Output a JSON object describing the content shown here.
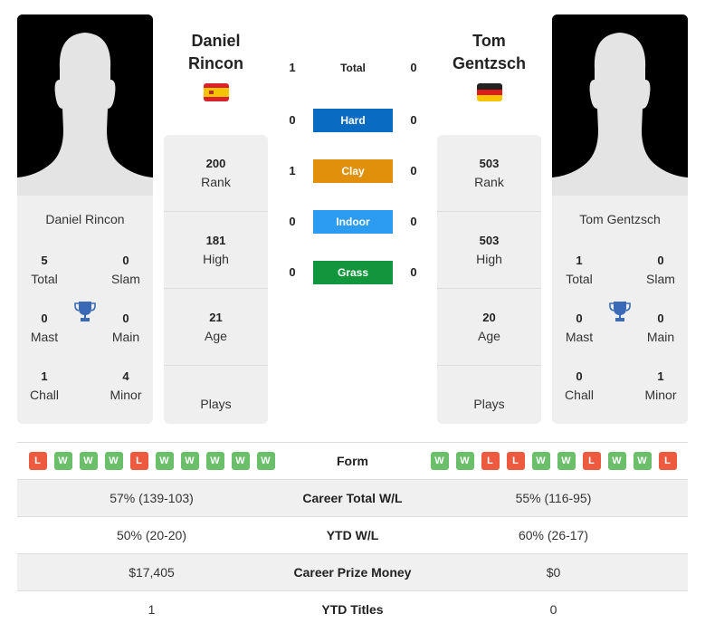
{
  "colors": {
    "hard": "#0a6bc2",
    "clay": "#e0900a",
    "indoor": "#2b9cf2",
    "grass": "#11963c",
    "win": "#6cbf6a",
    "loss": "#ee5a40",
    "trophy": "#3a6ab7"
  },
  "player1": {
    "name": "Daniel Rincon",
    "first_name": "Daniel",
    "last_name": "Rincon",
    "flag": "spain-flag",
    "titles": {
      "total": "5",
      "total_label": "Total",
      "slam": "0",
      "slam_label": "Slam",
      "mast": "0",
      "mast_label": "Mast",
      "main": "0",
      "main_label": "Main",
      "chall": "1",
      "chall_label": "Chall",
      "minor": "4",
      "minor_label": "Minor"
    },
    "info": {
      "rank": "200",
      "rank_label": "Rank",
      "high": "181",
      "high_label": "High",
      "age": "21",
      "age_label": "Age",
      "plays_label": "Plays"
    },
    "form": [
      "L",
      "W",
      "W",
      "W",
      "L",
      "W",
      "W",
      "W",
      "W",
      "W"
    ]
  },
  "player2": {
    "name": "Tom Gentzsch",
    "first_name": "Tom",
    "last_name": "Gentzsch",
    "flag": "germany-flag",
    "titles": {
      "total": "1",
      "total_label": "Total",
      "slam": "0",
      "slam_label": "Slam",
      "mast": "0",
      "mast_label": "Mast",
      "main": "0",
      "main_label": "Main",
      "chall": "0",
      "chall_label": "Chall",
      "minor": "1",
      "minor_label": "Minor"
    },
    "info": {
      "rank": "503",
      "rank_label": "Rank",
      "high": "503",
      "high_label": "High",
      "age": "20",
      "age_label": "Age",
      "plays_label": "Plays"
    },
    "form": [
      "W",
      "W",
      "L",
      "L",
      "W",
      "W",
      "L",
      "W",
      "W",
      "L"
    ]
  },
  "h2h": [
    {
      "label": "Total",
      "p1": "1",
      "p2": "0",
      "key": "total"
    },
    {
      "label": "Hard",
      "p1": "0",
      "p2": "0",
      "key": "hard"
    },
    {
      "label": "Clay",
      "p1": "1",
      "p2": "0",
      "key": "clay"
    },
    {
      "label": "Indoor",
      "p1": "0",
      "p2": "0",
      "key": "indoor"
    },
    {
      "label": "Grass",
      "p1": "0",
      "p2": "0",
      "key": "grass"
    }
  ],
  "table": {
    "form_label": "Form",
    "rows": [
      {
        "label": "Career Total W/L",
        "p1": "57% (139-103)",
        "p2": "55% (116-95)"
      },
      {
        "label": "YTD W/L",
        "p1": "50% (20-20)",
        "p2": "60% (26-17)"
      },
      {
        "label": "Career Prize Money",
        "p1": "$17,405",
        "p2": "$0"
      },
      {
        "label": "YTD Titles",
        "p1": "1",
        "p2": "0"
      }
    ]
  }
}
